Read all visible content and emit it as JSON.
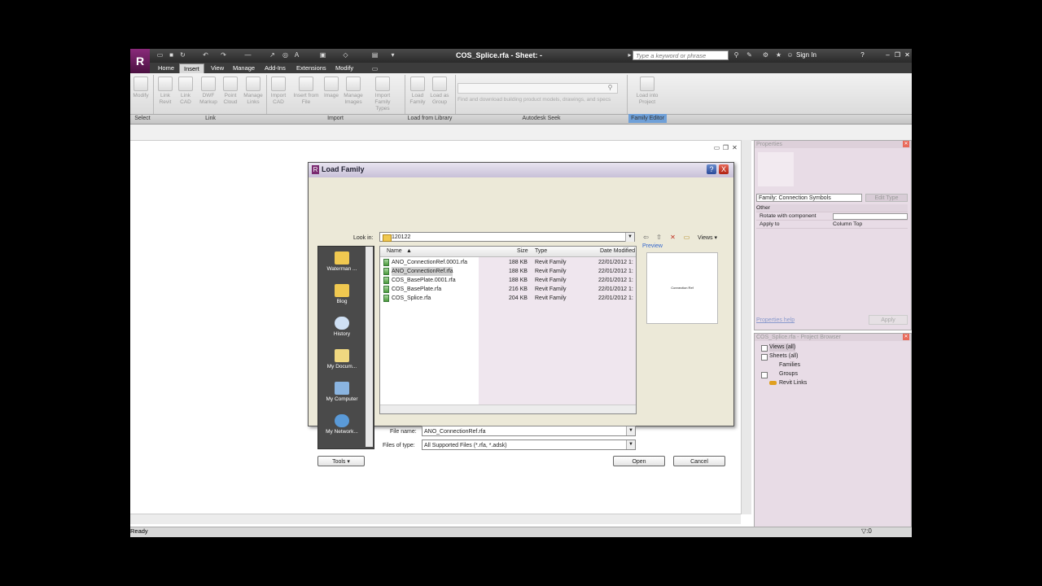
{
  "window": {
    "title": "COS_Splice.rfa - Sheet: -",
    "search_placeholder": "Type a keyword or phrase",
    "sign_in": "Sign In",
    "app_letter": "R"
  },
  "tabs": [
    "Home",
    "Insert",
    "View",
    "Manage",
    "Add-Ins",
    "Extensions",
    "Modify"
  ],
  "ribbon": {
    "buttons": [
      {
        "label": "Modify"
      },
      {
        "label": "Link Revit"
      },
      {
        "label": "Link CAD"
      },
      {
        "label": "DWF Markup"
      },
      {
        "label": "Point Cloud"
      },
      {
        "label": "Manage Links"
      },
      {
        "label": "Import CAD"
      },
      {
        "label": "Insert from File"
      },
      {
        "label": "Image"
      },
      {
        "label": "Manage Images"
      },
      {
        "label": "Import Family Types"
      },
      {
        "label": "Load Family"
      },
      {
        "label": "Load as Group"
      },
      {
        "label": "Load into Project"
      }
    ],
    "panels": [
      "Select",
      "Link",
      "Import",
      "Load from Library",
      "Autodesk Seek",
      "Family Editor"
    ],
    "seek_text": "Find and download building product models, drawings, and specs"
  },
  "status": {
    "text": "Ready",
    "filter_count": ":0"
  },
  "properties": {
    "title": "Properties",
    "family": "Family: Connection Symbols",
    "edit_type": "Edit Type",
    "group": "Other",
    "rows": [
      {
        "name": "Rotate with component",
        "value": ""
      },
      {
        "name": "Apply to",
        "value": "Column Top"
      }
    ],
    "help": "Properties help",
    "apply": "Apply"
  },
  "browser": {
    "title": "COS_Splice.rfa - Project Browser",
    "items": [
      "Views (all)",
      "Sheets (all)",
      "Families",
      "Groups",
      "Revit Links"
    ]
  },
  "dialog": {
    "title": "Load Family",
    "help": "?",
    "close": "X",
    "look_in_label": "Look in:",
    "look_in_value": "120122",
    "views": "Views",
    "preview_label": "Preview",
    "preview_text": "Connection Ref",
    "places": [
      "Waterman ...",
      "Blog",
      "History",
      "My Docum...",
      "My Computer",
      "My Network..."
    ],
    "columns": [
      "Name",
      "Size",
      "Type",
      "Date Modified"
    ],
    "files": [
      {
        "name": "ANO_ConnectionRef.0001.rfa",
        "size": "188 KB",
        "type": "Revit Family",
        "date": "22/01/2012 1:"
      },
      {
        "name": "ANO_ConnectionRef.rfa",
        "size": "188 KB",
        "type": "Revit Family",
        "date": "22/01/2012 1:"
      },
      {
        "name": "COS_BasePlate.0001.rfa",
        "size": "188 KB",
        "type": "Revit Family",
        "date": "22/01/2012 1:"
      },
      {
        "name": "COS_BasePlate.rfa",
        "size": "216 KB",
        "type": "Revit Family",
        "date": "22/01/2012 1:"
      },
      {
        "name": "COS_Splice.rfa",
        "size": "204 KB",
        "type": "Revit Family",
        "date": "22/01/2012 1:"
      }
    ],
    "file_name_label": "File name:",
    "file_name": "ANO_ConnectionRef.rfa",
    "file_type_label": "Files of type:",
    "file_type": "All Supported Files  (*.rfa,  *.adsk)",
    "tools": "Tools",
    "open": "Open",
    "cancel": "Cancel"
  }
}
